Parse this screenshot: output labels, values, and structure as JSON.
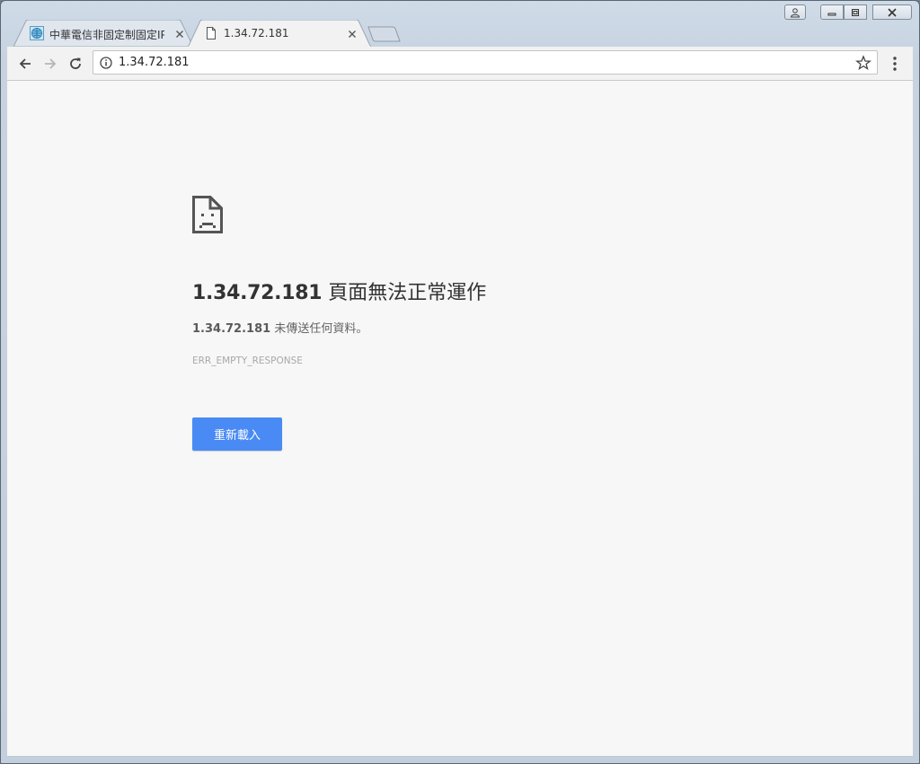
{
  "tabs": [
    {
      "title": "中華電信非固定制固定IP",
      "favicon": "site-globe-icon"
    },
    {
      "title": "1.34.72.181",
      "favicon": "blank-page-icon"
    }
  ],
  "toolbar": {
    "url": "1.34.72.181",
    "back_icon": "arrow-left-icon",
    "forward_icon": "arrow-right-icon",
    "reload_icon": "reload-icon",
    "info_icon": "info-icon",
    "bookmark_icon": "star-icon",
    "menu_icon": "kebab-menu-icon"
  },
  "error_page": {
    "host": "1.34.72.181",
    "heading_suffix": " 頁面無法正常運作",
    "desc_suffix": " 未傳送任何資料。",
    "error_code": "ERR_EMPTY_RESPONSE",
    "reload_label": "重新載入",
    "icon": "sad-page-icon"
  },
  "colors": {
    "reload_button": "#4a8af4",
    "page_background": "#f7f7f7",
    "window_frame": "#cfdbe7"
  }
}
